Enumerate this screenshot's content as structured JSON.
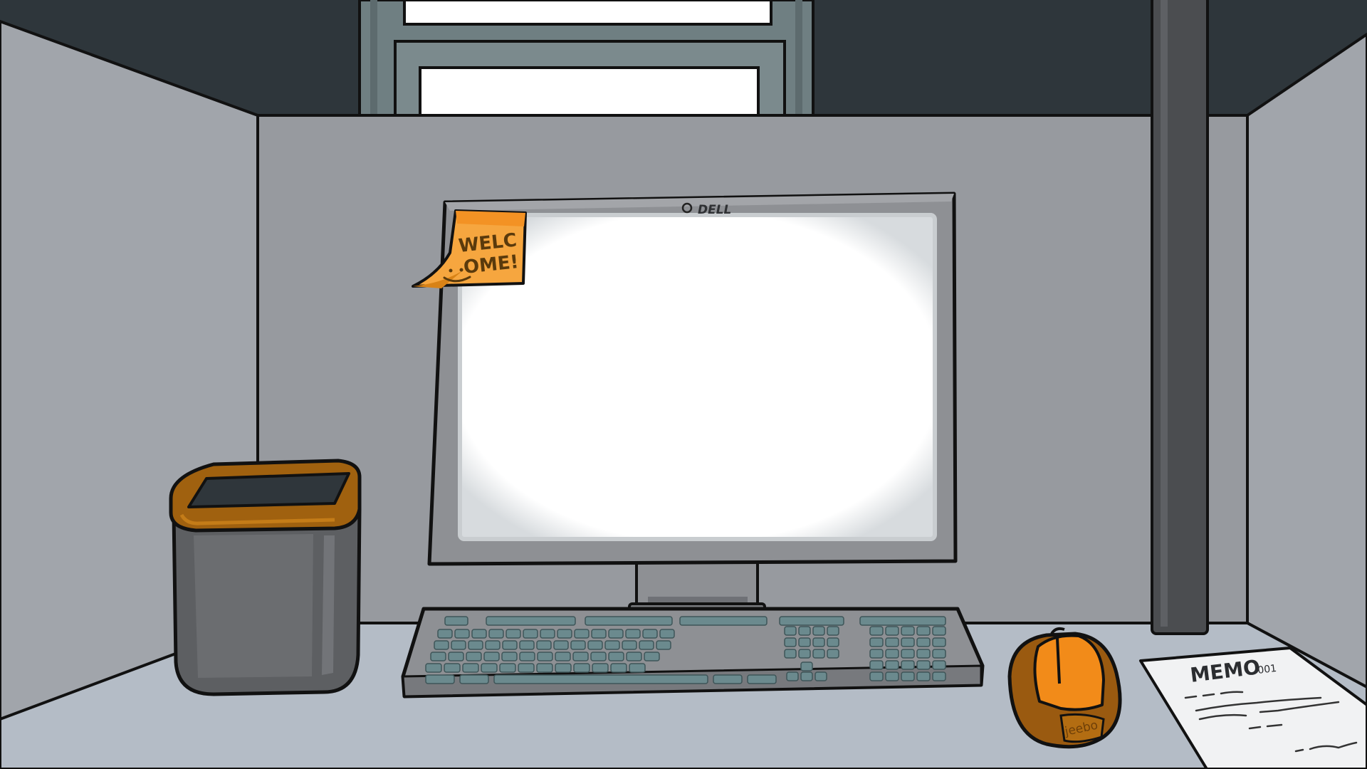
{
  "scene": {
    "sticky_note": {
      "line1": "WELC",
      "line2": "OME!",
      "smiley": "smiley-face"
    },
    "monitor": {
      "brand": "DELL"
    },
    "mouse": {
      "brand": "jeebo"
    },
    "memo": {
      "title": "MEMO",
      "number": "001"
    }
  },
  "colors": {
    "ceiling": "#2e363b",
    "window_frame": "#6f7f82",
    "back_wall": "#979a9f",
    "side_wall": "#a1a5ab",
    "desk": "#b4bcc6",
    "pillar": "#4b4d50",
    "monitor_bezel": "#8e9094",
    "screen": "#ffffff",
    "keycap": "#6b8a8e",
    "accent_orange": "#f28b19",
    "accent_brown": "#9a5a10",
    "bin_body": "#5d5f62"
  }
}
